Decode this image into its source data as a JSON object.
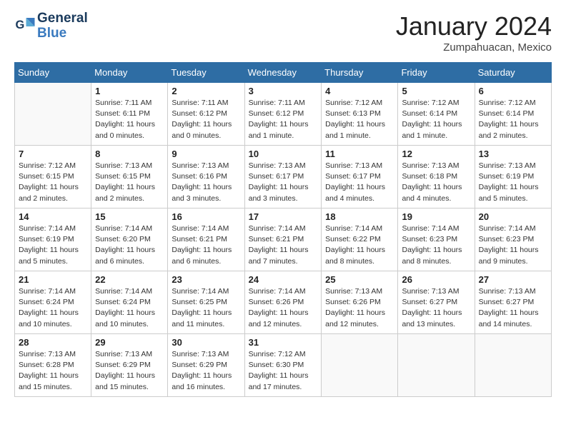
{
  "header": {
    "logo_line1": "General",
    "logo_line2": "Blue",
    "month": "January 2024",
    "location": "Zumpahuacan, Mexico"
  },
  "days_of_week": [
    "Sunday",
    "Monday",
    "Tuesday",
    "Wednesday",
    "Thursday",
    "Friday",
    "Saturday"
  ],
  "weeks": [
    [
      {
        "day": "",
        "detail": ""
      },
      {
        "day": "1",
        "detail": "Sunrise: 7:11 AM\nSunset: 6:11 PM\nDaylight: 11 hours\nand 0 minutes."
      },
      {
        "day": "2",
        "detail": "Sunrise: 7:11 AM\nSunset: 6:12 PM\nDaylight: 11 hours\nand 0 minutes."
      },
      {
        "day": "3",
        "detail": "Sunrise: 7:11 AM\nSunset: 6:12 PM\nDaylight: 11 hours\nand 1 minute."
      },
      {
        "day": "4",
        "detail": "Sunrise: 7:12 AM\nSunset: 6:13 PM\nDaylight: 11 hours\nand 1 minute."
      },
      {
        "day": "5",
        "detail": "Sunrise: 7:12 AM\nSunset: 6:14 PM\nDaylight: 11 hours\nand 1 minute."
      },
      {
        "day": "6",
        "detail": "Sunrise: 7:12 AM\nSunset: 6:14 PM\nDaylight: 11 hours\nand 2 minutes."
      }
    ],
    [
      {
        "day": "7",
        "detail": "Sunrise: 7:12 AM\nSunset: 6:15 PM\nDaylight: 11 hours\nand 2 minutes."
      },
      {
        "day": "8",
        "detail": "Sunrise: 7:13 AM\nSunset: 6:15 PM\nDaylight: 11 hours\nand 2 minutes."
      },
      {
        "day": "9",
        "detail": "Sunrise: 7:13 AM\nSunset: 6:16 PM\nDaylight: 11 hours\nand 3 minutes."
      },
      {
        "day": "10",
        "detail": "Sunrise: 7:13 AM\nSunset: 6:17 PM\nDaylight: 11 hours\nand 3 minutes."
      },
      {
        "day": "11",
        "detail": "Sunrise: 7:13 AM\nSunset: 6:17 PM\nDaylight: 11 hours\nand 4 minutes."
      },
      {
        "day": "12",
        "detail": "Sunrise: 7:13 AM\nSunset: 6:18 PM\nDaylight: 11 hours\nand 4 minutes."
      },
      {
        "day": "13",
        "detail": "Sunrise: 7:13 AM\nSunset: 6:19 PM\nDaylight: 11 hours\nand 5 minutes."
      }
    ],
    [
      {
        "day": "14",
        "detail": "Sunrise: 7:14 AM\nSunset: 6:19 PM\nDaylight: 11 hours\nand 5 minutes."
      },
      {
        "day": "15",
        "detail": "Sunrise: 7:14 AM\nSunset: 6:20 PM\nDaylight: 11 hours\nand 6 minutes."
      },
      {
        "day": "16",
        "detail": "Sunrise: 7:14 AM\nSunset: 6:21 PM\nDaylight: 11 hours\nand 6 minutes."
      },
      {
        "day": "17",
        "detail": "Sunrise: 7:14 AM\nSunset: 6:21 PM\nDaylight: 11 hours\nand 7 minutes."
      },
      {
        "day": "18",
        "detail": "Sunrise: 7:14 AM\nSunset: 6:22 PM\nDaylight: 11 hours\nand 8 minutes."
      },
      {
        "day": "19",
        "detail": "Sunrise: 7:14 AM\nSunset: 6:23 PM\nDaylight: 11 hours\nand 8 minutes."
      },
      {
        "day": "20",
        "detail": "Sunrise: 7:14 AM\nSunset: 6:23 PM\nDaylight: 11 hours\nand 9 minutes."
      }
    ],
    [
      {
        "day": "21",
        "detail": "Sunrise: 7:14 AM\nSunset: 6:24 PM\nDaylight: 11 hours\nand 10 minutes."
      },
      {
        "day": "22",
        "detail": "Sunrise: 7:14 AM\nSunset: 6:24 PM\nDaylight: 11 hours\nand 10 minutes."
      },
      {
        "day": "23",
        "detail": "Sunrise: 7:14 AM\nSunset: 6:25 PM\nDaylight: 11 hours\nand 11 minutes."
      },
      {
        "day": "24",
        "detail": "Sunrise: 7:14 AM\nSunset: 6:26 PM\nDaylight: 11 hours\nand 12 minutes."
      },
      {
        "day": "25",
        "detail": "Sunrise: 7:13 AM\nSunset: 6:26 PM\nDaylight: 11 hours\nand 12 minutes."
      },
      {
        "day": "26",
        "detail": "Sunrise: 7:13 AM\nSunset: 6:27 PM\nDaylight: 11 hours\nand 13 minutes."
      },
      {
        "day": "27",
        "detail": "Sunrise: 7:13 AM\nSunset: 6:27 PM\nDaylight: 11 hours\nand 14 minutes."
      }
    ],
    [
      {
        "day": "28",
        "detail": "Sunrise: 7:13 AM\nSunset: 6:28 PM\nDaylight: 11 hours\nand 15 minutes."
      },
      {
        "day": "29",
        "detail": "Sunrise: 7:13 AM\nSunset: 6:29 PM\nDaylight: 11 hours\nand 15 minutes."
      },
      {
        "day": "30",
        "detail": "Sunrise: 7:13 AM\nSunset: 6:29 PM\nDaylight: 11 hours\nand 16 minutes."
      },
      {
        "day": "31",
        "detail": "Sunrise: 7:12 AM\nSunset: 6:30 PM\nDaylight: 11 hours\nand 17 minutes."
      },
      {
        "day": "",
        "detail": ""
      },
      {
        "day": "",
        "detail": ""
      },
      {
        "day": "",
        "detail": ""
      }
    ]
  ]
}
